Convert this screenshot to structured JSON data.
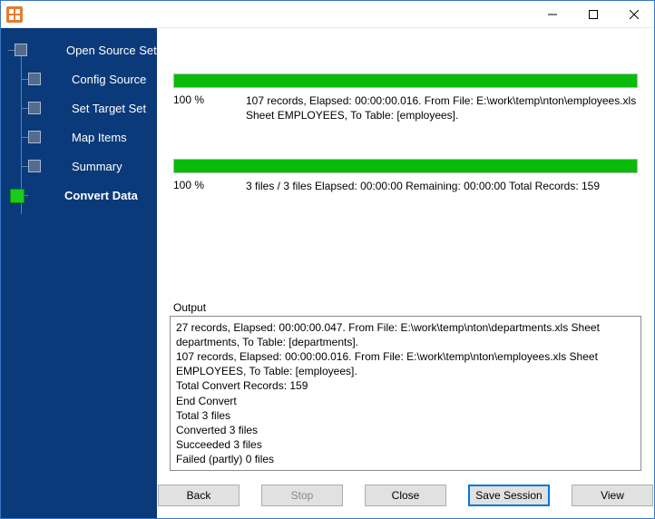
{
  "colors": {
    "sidebar_bg": "#0b3a7a",
    "progress_fill": "#0bbb0b",
    "accent_border": "#0078d7",
    "app_icon_bg": "#e87b2e"
  },
  "window": {
    "title": ""
  },
  "sidebar": {
    "steps": [
      {
        "label": "Open Source Set",
        "level": 0,
        "active": false
      },
      {
        "label": "Config Source",
        "level": 1,
        "active": false
      },
      {
        "label": "Set Target Set",
        "level": 1,
        "active": false
      },
      {
        "label": "Map Items",
        "level": 1,
        "active": false
      },
      {
        "label": "Summary",
        "level": 1,
        "active": false
      },
      {
        "label": "Convert Data",
        "level": 0,
        "active": true
      }
    ]
  },
  "progress": {
    "file": {
      "percent": "100 %",
      "detail": "107 records,    Elapsed: 00:00:00.016.    From File: E:\\work\\temp\\nton\\employees.xls Sheet EMPLOYEES,    To Table: [employees]."
    },
    "total": {
      "percent": "100 %",
      "detail": "3 files / 3 files    Elapsed: 00:00:00    Remaining: 00:00:00    Total Records: 159"
    }
  },
  "output": {
    "label": "Output",
    "lines": [
      "27 records,    Elapsed: 00:00:00.047.    From File: E:\\work\\temp\\nton\\departments.xls Sheet departments,    To Table: [departments].",
      "107 records,    Elapsed: 00:00:00.016.    From File: E:\\work\\temp\\nton\\employees.xls Sheet EMPLOYEES,    To Table: [employees].",
      "Total Convert Records: 159",
      "End Convert",
      "Total 3 files",
      "Converted 3 files",
      "Succeeded 3 files",
      "Failed (partly) 0 files"
    ]
  },
  "buttons": {
    "back": "Back",
    "stop": "Stop",
    "close": "Close",
    "save_session": "Save Session",
    "view": "View"
  }
}
